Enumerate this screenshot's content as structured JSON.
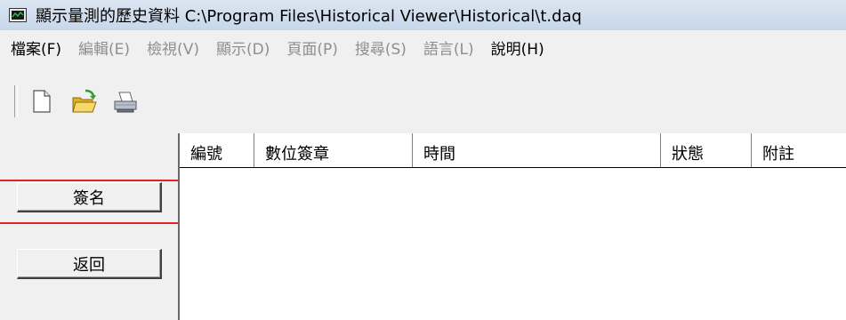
{
  "window": {
    "title": "顯示量測的歷史資料 C:\\Program Files\\Historical Viewer\\Historical\\t.daq",
    "icon": "chart-monitor-icon"
  },
  "menu": {
    "items": [
      {
        "label": "檔案(F)",
        "enabled": true
      },
      {
        "label": "編輯(E)",
        "enabled": false
      },
      {
        "label": "檢視(V)",
        "enabled": false
      },
      {
        "label": "顯示(D)",
        "enabled": false
      },
      {
        "label": "頁面(P)",
        "enabled": false
      },
      {
        "label": "搜尋(S)",
        "enabled": false
      },
      {
        "label": "語言(L)",
        "enabled": false
      },
      {
        "label": "說明(H)",
        "enabled": true
      }
    ]
  },
  "toolbar": {
    "buttons": [
      {
        "icon": "new-document-icon"
      },
      {
        "icon": "open-folder-icon"
      },
      {
        "icon": "print-icon"
      }
    ]
  },
  "side": {
    "sign_label": "簽名",
    "back_label": "返回"
  },
  "list": {
    "columns": [
      "編號",
      "數位簽章",
      "時間",
      "狀態",
      "附註"
    ]
  },
  "colors": {
    "highlight": "#e02424"
  }
}
